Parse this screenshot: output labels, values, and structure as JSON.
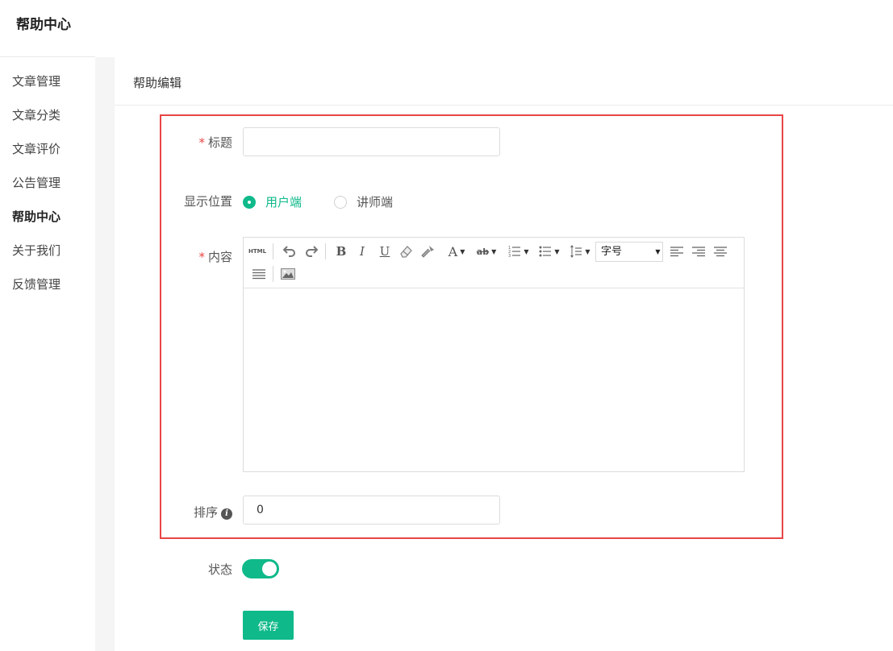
{
  "app": {
    "title": "帮助中心"
  },
  "sidebar": {
    "items": [
      {
        "label": "文章管理"
      },
      {
        "label": "文章分类"
      },
      {
        "label": "文章评价"
      },
      {
        "label": "公告管理"
      },
      {
        "label": "帮助中心",
        "active": true
      },
      {
        "label": "关于我们"
      },
      {
        "label": "反馈管理"
      }
    ]
  },
  "main": {
    "title": "帮助编辑"
  },
  "form": {
    "title_field": {
      "label": "标题",
      "required_mark": "*",
      "value": ""
    },
    "position": {
      "label": "显示位置",
      "options": [
        {
          "label": "用户端",
          "checked": true
        },
        {
          "label": "讲师端",
          "checked": false
        }
      ]
    },
    "content": {
      "label": "内容",
      "required_mark": "*",
      "toolbar": {
        "html_label": "HTML",
        "bold_label": "B",
        "italic_label": "I",
        "underline_label": "U",
        "fontcolor_label": "A",
        "highlight_label": "ab",
        "font_size_placeholder": "字号"
      }
    },
    "sort": {
      "label": "排序",
      "value": "0",
      "info_glyph": "i"
    },
    "status": {
      "label": "状态",
      "enabled": true
    },
    "save_label": "保存"
  },
  "colors": {
    "accent": "#0fb98a",
    "required": "#e84545",
    "highlight_border": "#e84545"
  }
}
